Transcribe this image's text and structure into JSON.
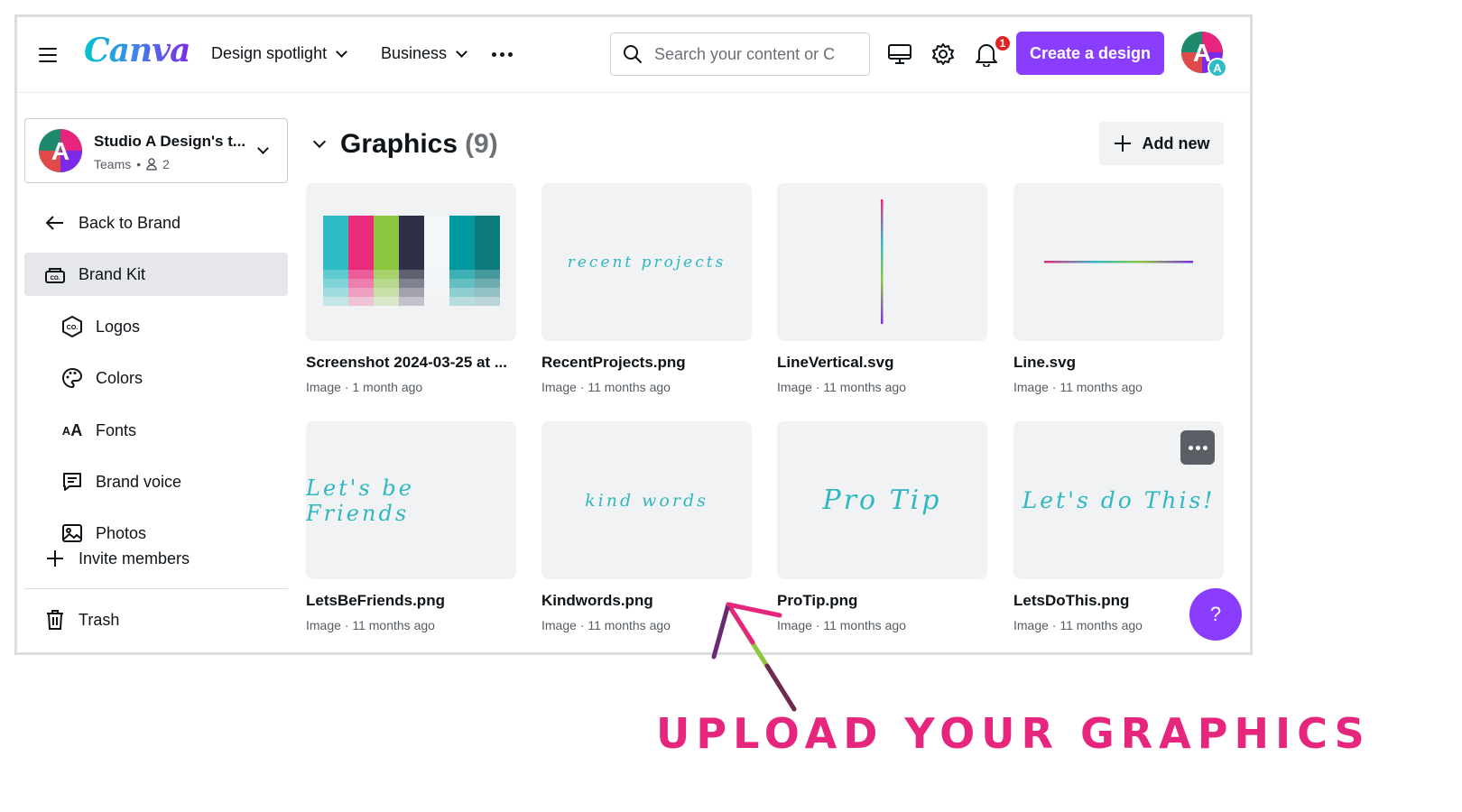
{
  "header": {
    "logo": "Canva",
    "nav": [
      {
        "label": "Design spotlight"
      },
      {
        "label": "Business"
      }
    ],
    "search_placeholder": "Search your content or Canva's",
    "notification_count": "1",
    "create_label": "Create a design"
  },
  "sidebar": {
    "team": {
      "name": "Studio A Design's t...",
      "type": "Teams",
      "members": "2"
    },
    "back": "Back to Brand",
    "items": [
      {
        "label": "Brand Kit"
      },
      {
        "label": "Logos"
      },
      {
        "label": "Colors"
      },
      {
        "label": "Fonts"
      },
      {
        "label": "Brand voice"
      },
      {
        "label": "Photos"
      }
    ],
    "invite": "Invite members",
    "trash": "Trash"
  },
  "main": {
    "section_title": "Graphics",
    "section_count": "(9)",
    "add_new": "Add new",
    "cards": [
      {
        "title": "Screenshot 2024-03-25 at ...",
        "meta": "Image · 1 month ago"
      },
      {
        "title": "RecentProjects.png",
        "meta": "Image · 11 months ago",
        "script": "recent projects"
      },
      {
        "title": "LineVertical.svg",
        "meta": "Image · 11 months ago"
      },
      {
        "title": "Line.svg",
        "meta": "Image · 11 months ago"
      },
      {
        "title": "LetsBeFriends.png",
        "meta": "Image · 11 months ago",
        "script": "Let's be Friends"
      },
      {
        "title": "Kindwords.png",
        "meta": "Image · 11 months ago",
        "script": "kind words"
      },
      {
        "title": "ProTip.png",
        "meta": "Image · 11 months ago",
        "script": "Pro Tip"
      },
      {
        "title": "LetsDoThis.png",
        "meta": "Image · 11 months ago",
        "script": "Let's do This!"
      }
    ],
    "help": "?"
  },
  "annotation": {
    "caption": "UPLOAD YOUR GRAPHICS"
  },
  "colors": {
    "accent": "#8b3dff",
    "annotation": "#e6267d",
    "palette": [
      "#2ebdc4",
      "#ea2a7a",
      "#8dc63f",
      "#2d3047",
      "#f2f7f9",
      "#00999f",
      "#0d7a7c"
    ]
  }
}
